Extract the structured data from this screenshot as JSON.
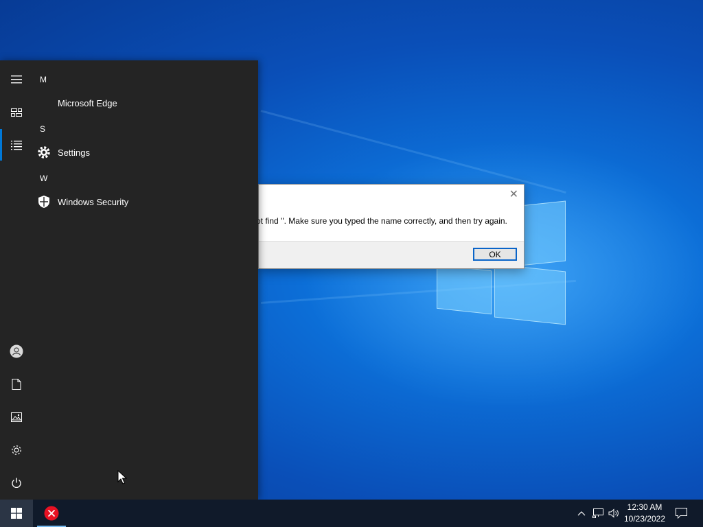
{
  "start_menu": {
    "groups": [
      {
        "letter": "M",
        "apps": [
          {
            "label": "Microsoft Edge",
            "icon": "edge-icon"
          }
        ]
      },
      {
        "letter": "S",
        "apps": [
          {
            "label": "Settings",
            "icon": "gear-icon"
          }
        ]
      },
      {
        "letter": "W",
        "apps": [
          {
            "label": "Windows Security",
            "icon": "shield-icon"
          }
        ]
      }
    ],
    "rail_icons": [
      "hamburger-icon",
      "tiles-icon",
      "all-apps-list-icon",
      "user-icon",
      "documents-icon",
      "pictures-icon",
      "settings-icon",
      "power-icon"
    ]
  },
  "dialog": {
    "message": "ot find ''. Make sure you typed the name correctly, and then try again.",
    "ok_label": "OK",
    "close_glyph": "✕"
  },
  "taskbar": {
    "time": "12:30 AM",
    "date": "10/23/2022",
    "pinned_app_icon": "error-icon"
  },
  "colors": {
    "start_bg": "#242424",
    "accent": "#0078d7",
    "taskbar_bg": "#101a2a",
    "error_red": "#e81123"
  }
}
